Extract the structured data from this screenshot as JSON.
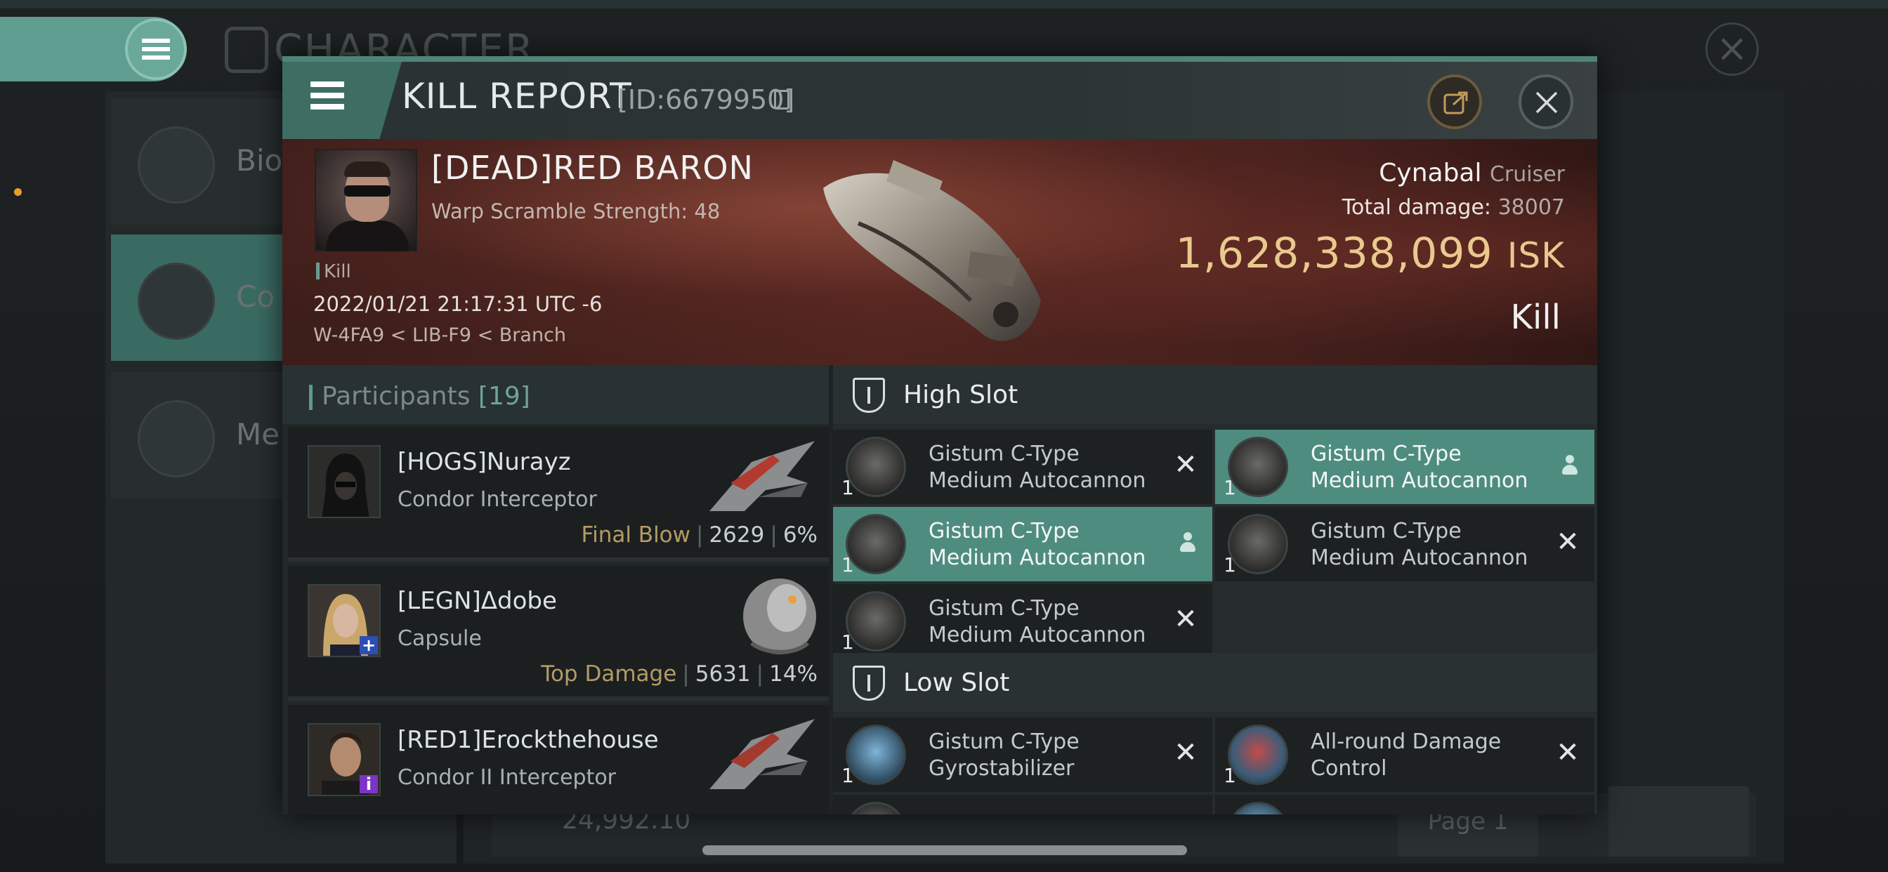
{
  "background": {
    "title": "CHARACTER",
    "nav_items": [
      {
        "label": "Bio"
      },
      {
        "label": "Co"
      },
      {
        "label": "Me"
      }
    ],
    "isk_balance": "24,992.10",
    "page_label": "Page 1"
  },
  "kill_report": {
    "title": "KILL REPORT",
    "id_text": "[ID:6679950]",
    "victim": {
      "name": "[DEAD]RED BARON",
      "warp_scramble": "Warp Scramble Strength: 48",
      "tag": "Kill",
      "timestamp": "2022/01/21 21:17:31 UTC -6",
      "location": "W-4FA9 < LIB-F9 < Branch"
    },
    "ship": {
      "name": "Cynabal",
      "class": "Cruiser",
      "total_damage_label": "Total damage:",
      "total_damage": "38007",
      "isk_value": "1,628,338,099",
      "isk_unit": "ISK",
      "result": "Kill"
    },
    "participants": {
      "title": "Participants",
      "count": "[19]",
      "rows": [
        {
          "name": "[HOGS]Nurayz",
          "ship": "Condor Interceptor",
          "label": "Final Blow",
          "damage": "2629",
          "percent": "6%"
        },
        {
          "name": "[LEGN]ᐃdobe",
          "ship": "Capsule",
          "label": "Top Damage",
          "damage": "5631",
          "percent": "14%"
        },
        {
          "name": "[RED1]Erockthehouse",
          "ship": "Condor II Interceptor",
          "label": "",
          "damage": "",
          "percent": ""
        }
      ]
    },
    "high_slot": {
      "title": "High Slot",
      "modules": [
        {
          "name_line1": "Gistum C-Type",
          "name_line2": "Medium Autocannon",
          "qty": "1",
          "state": "destroyed"
        },
        {
          "name_line1": "Gistum C-Type",
          "name_line2": "Medium Autocannon",
          "qty": "1",
          "state": "dropped"
        },
        {
          "name_line1": "Gistum C-Type",
          "name_line2": "Medium Autocannon",
          "qty": "1",
          "state": "dropped"
        },
        {
          "name_line1": "Gistum C-Type",
          "name_line2": "Medium Autocannon",
          "qty": "1",
          "state": "destroyed"
        },
        {
          "name_line1": "Gistum C-Type",
          "name_line2": "Medium Autocannon",
          "qty": "1",
          "state": "destroyed"
        }
      ]
    },
    "low_slot": {
      "title": "Low Slot",
      "modules": [
        {
          "name_line1": "Gistum C-Type",
          "name_line2": "Gyrostabilizer",
          "qty": "1",
          "state": "destroyed"
        },
        {
          "name_line1": "All-round Damage",
          "name_line2": "Control",
          "qty": "1",
          "state": "destroyed"
        }
      ]
    }
  },
  "colors": {
    "accent": "#5e9d8f",
    "isk_gold": "#e8c98e",
    "active_module": "#4f8c80"
  }
}
